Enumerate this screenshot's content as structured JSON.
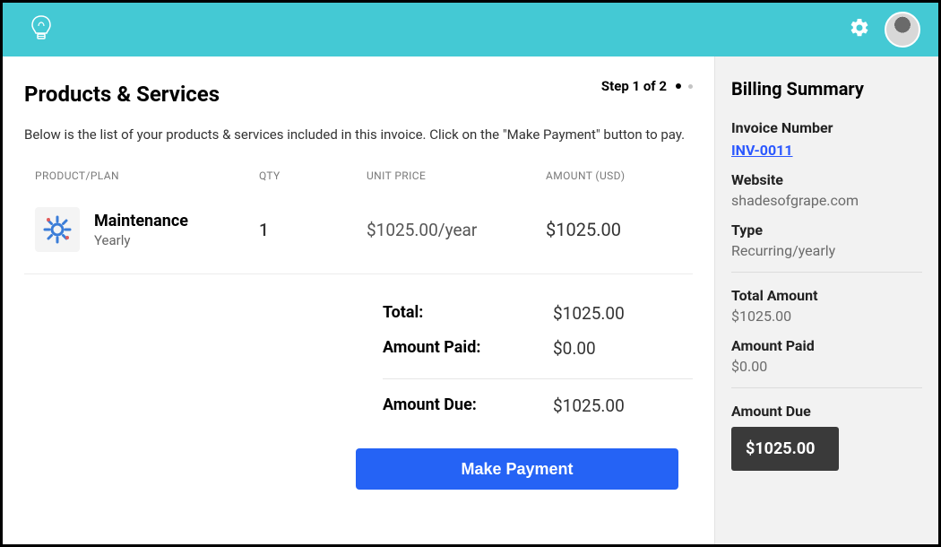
{
  "header": {},
  "stepper": {
    "label": "Step 1 of 2"
  },
  "main": {
    "title": "Products & Services",
    "subtitle": "Below is the list of your products & services included in this invoice. Click on the \"Make Payment\" button to pay.",
    "columns": {
      "product": "PRODUCT/PLAN",
      "qty": "QTY",
      "unit_price": "UNIT PRICE",
      "amount": "AMOUNT (USD)"
    },
    "items": [
      {
        "name": "Maintenance",
        "cycle": "Yearly",
        "qty": "1",
        "unit_price": "$1025.00/year",
        "amount": "$1025.00",
        "icon": "gear-icon"
      }
    ],
    "totals": {
      "total_label": "Total:",
      "total_value": "$1025.00",
      "paid_label": "Amount Paid:",
      "paid_value": "$0.00",
      "due_label": "Amount Due:",
      "due_value": "$1025.00"
    },
    "pay_button": "Make Payment"
  },
  "sidebar": {
    "title": "Billing Summary",
    "invoice_number_label": "Invoice Number",
    "invoice_number": "INV-0011",
    "website_label": "Website",
    "website": "shadesofgrape.com",
    "type_label": "Type",
    "type": "Recurring/yearly",
    "total_amount_label": "Total Amount",
    "total_amount": "$1025.00",
    "amount_paid_label": "Amount Paid",
    "amount_paid": "$0.00",
    "amount_due_label": "Amount Due",
    "amount_due": "$1025.00"
  }
}
